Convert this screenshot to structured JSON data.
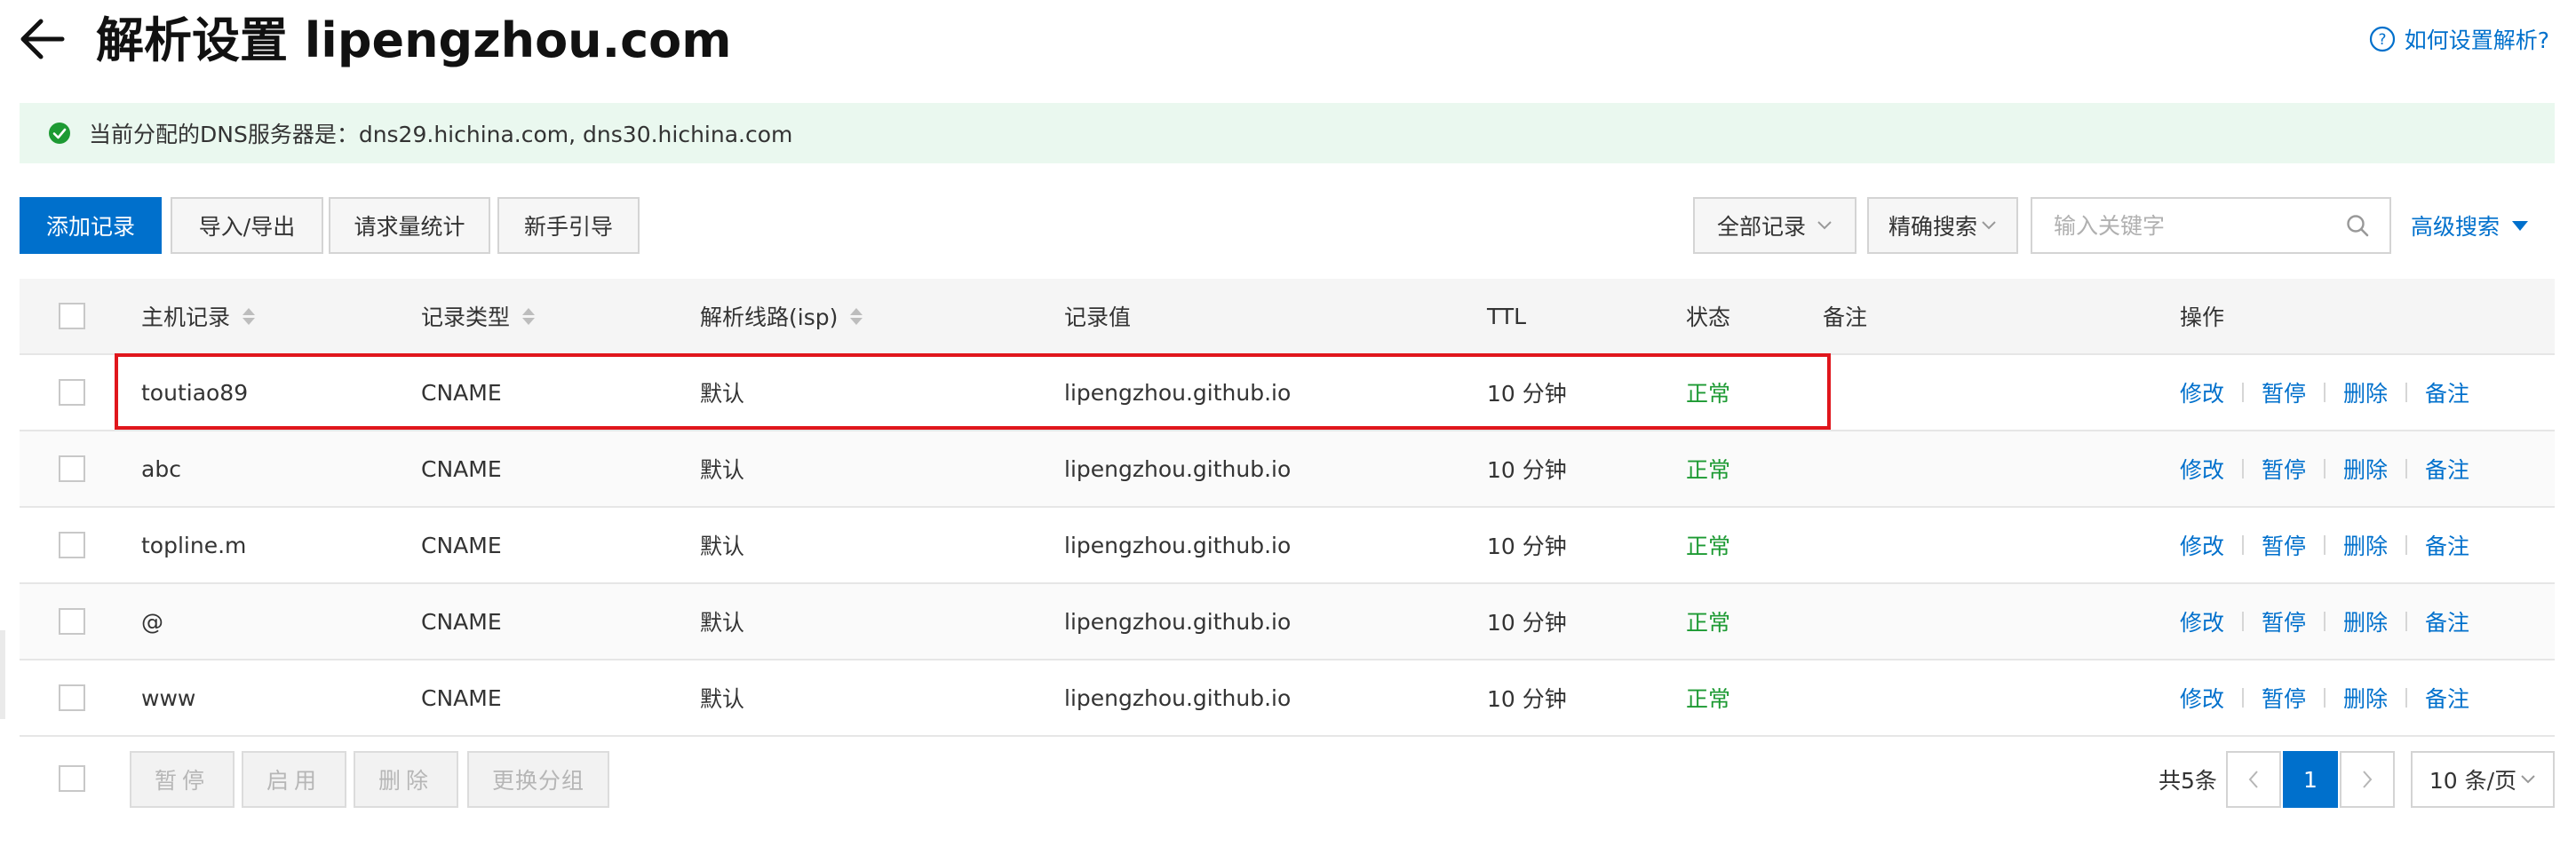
{
  "header": {
    "title": "解析设置 lipengzhou.com",
    "help_link": "如何设置解析?"
  },
  "notice": {
    "text": "当前分配的DNS服务器是：dns29.hichina.com, dns30.hichina.com"
  },
  "toolbar": {
    "add_record": "添加记录",
    "import_export": "导入/导出",
    "request_stats": "请求量统计",
    "beginner_guide": "新手引导",
    "record_filter": "全部记录",
    "exact_search": "精确搜索",
    "search_placeholder": "输入关键字",
    "advanced_search": "高级搜索"
  },
  "table": {
    "columns": {
      "host": "主机记录",
      "type": "记录类型",
      "line": "解析线路(isp)",
      "value": "记录值",
      "ttl": "TTL",
      "status": "状态",
      "remark": "备注",
      "actions": "操作"
    },
    "rows": [
      {
        "host": "toutiao89",
        "type": "CNAME",
        "line": "默认",
        "value": "lipengzhou.github.io",
        "ttl": "10 分钟",
        "status": "正常"
      },
      {
        "host": "abc",
        "type": "CNAME",
        "line": "默认",
        "value": "lipengzhou.github.io",
        "ttl": "10 分钟",
        "status": "正常"
      },
      {
        "host": "topline.m",
        "type": "CNAME",
        "line": "默认",
        "value": "lipengzhou.github.io",
        "ttl": "10 分钟",
        "status": "正常"
      },
      {
        "host": "@",
        "type": "CNAME",
        "line": "默认",
        "value": "lipengzhou.github.io",
        "ttl": "10 分钟",
        "status": "正常"
      },
      {
        "host": "www",
        "type": "CNAME",
        "line": "默认",
        "value": "lipengzhou.github.io",
        "ttl": "10 分钟",
        "status": "正常"
      }
    ],
    "row_actions": {
      "edit": "修改",
      "pause": "暂停",
      "delete": "删除",
      "remark": "备注"
    }
  },
  "footer": {
    "bulk_pause": "暂停",
    "bulk_enable": "启用",
    "bulk_delete": "删除",
    "bulk_change_group": "更换分组",
    "total": "共5条",
    "current_page": "1",
    "page_size": "10 条/页"
  },
  "colors": {
    "primary": "#0070cc",
    "status_ok": "#1d9a33",
    "highlight": "#e0161c",
    "notice_bg": "#eaf8ef"
  },
  "icons": [
    "back-arrow-icon",
    "help-circle-icon",
    "check-circle-icon",
    "chevron-down-icon",
    "search-icon",
    "sort-icon",
    "triangle-down-icon",
    "chevron-left-icon",
    "chevron-right-icon"
  ]
}
